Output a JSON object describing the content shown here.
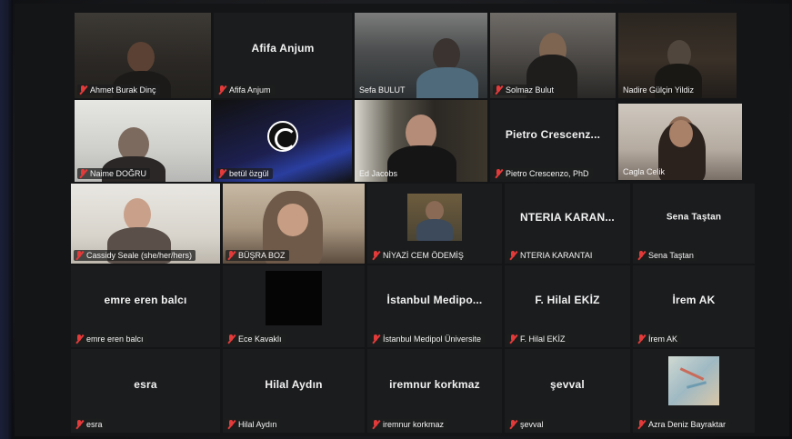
{
  "participants": [
    {
      "name": "Ahmet Burak Dinç",
      "display": "",
      "muted": true
    },
    {
      "name": "Afifa Anjum",
      "display": "Afifa Anjum",
      "muted": true
    },
    {
      "name": "Sefa BULUT",
      "display": "",
      "muted": false
    },
    {
      "name": "Solmaz Bulut",
      "display": "",
      "muted": true
    },
    {
      "name": "Nadire Gülçin Yildiz",
      "display": "",
      "muted": false
    },
    {
      "name": "Naime DOĞRU",
      "display": "",
      "muted": true
    },
    {
      "name": "betül özgül",
      "display": "",
      "muted": true
    },
    {
      "name": "Ed Jacobs",
      "display": "",
      "muted": false
    },
    {
      "name": "Pietro Crescenzo, PhD",
      "display": "Pietro Crescenz...",
      "muted": true
    },
    {
      "name": "Cagla Celik",
      "display": "",
      "muted": false
    },
    {
      "name": "Cassidy Seale (she/her/hers)",
      "display": "",
      "muted": true
    },
    {
      "name": "BÜŞRA BOZ",
      "display": "",
      "muted": true
    },
    {
      "name": "NİYAZİ CEM ÖDEMİŞ",
      "display": "",
      "muted": true
    },
    {
      "name": "NTERIA KARANTAI",
      "display": "NTERIA KARAN...",
      "muted": true
    },
    {
      "name": "Sena Taştan",
      "display": "Sena Taştan",
      "muted": true
    },
    {
      "name": "emre eren balcı",
      "display": "emre eren balcı",
      "muted": true
    },
    {
      "name": "Ece Kavaklı",
      "display": "",
      "muted": true
    },
    {
      "name": "İstanbul Medipol Üniversite",
      "display": "İstanbul Medipo...",
      "muted": true
    },
    {
      "name": "F. Hilal EKİZ",
      "display": "F. Hilal EKİZ",
      "muted": true
    },
    {
      "name": "İrem AK",
      "display": "İrem AK",
      "muted": true
    },
    {
      "name": "esra",
      "display": "esra",
      "muted": true
    },
    {
      "name": "Hilal Aydın",
      "display": "Hilal Aydın",
      "muted": true
    },
    {
      "name": "iremnur korkmaz",
      "display": "iremnur korkmaz",
      "muted": true
    },
    {
      "name": "şevval",
      "display": "şevval",
      "muted": true
    },
    {
      "name": "Azra Deniz Bayraktar",
      "display": "",
      "muted": true
    }
  ],
  "colors": {
    "active_speaker_border": "#e4e04a",
    "muted_icon": "#e33a3a",
    "tile_bg": "#1b1c1e"
  }
}
